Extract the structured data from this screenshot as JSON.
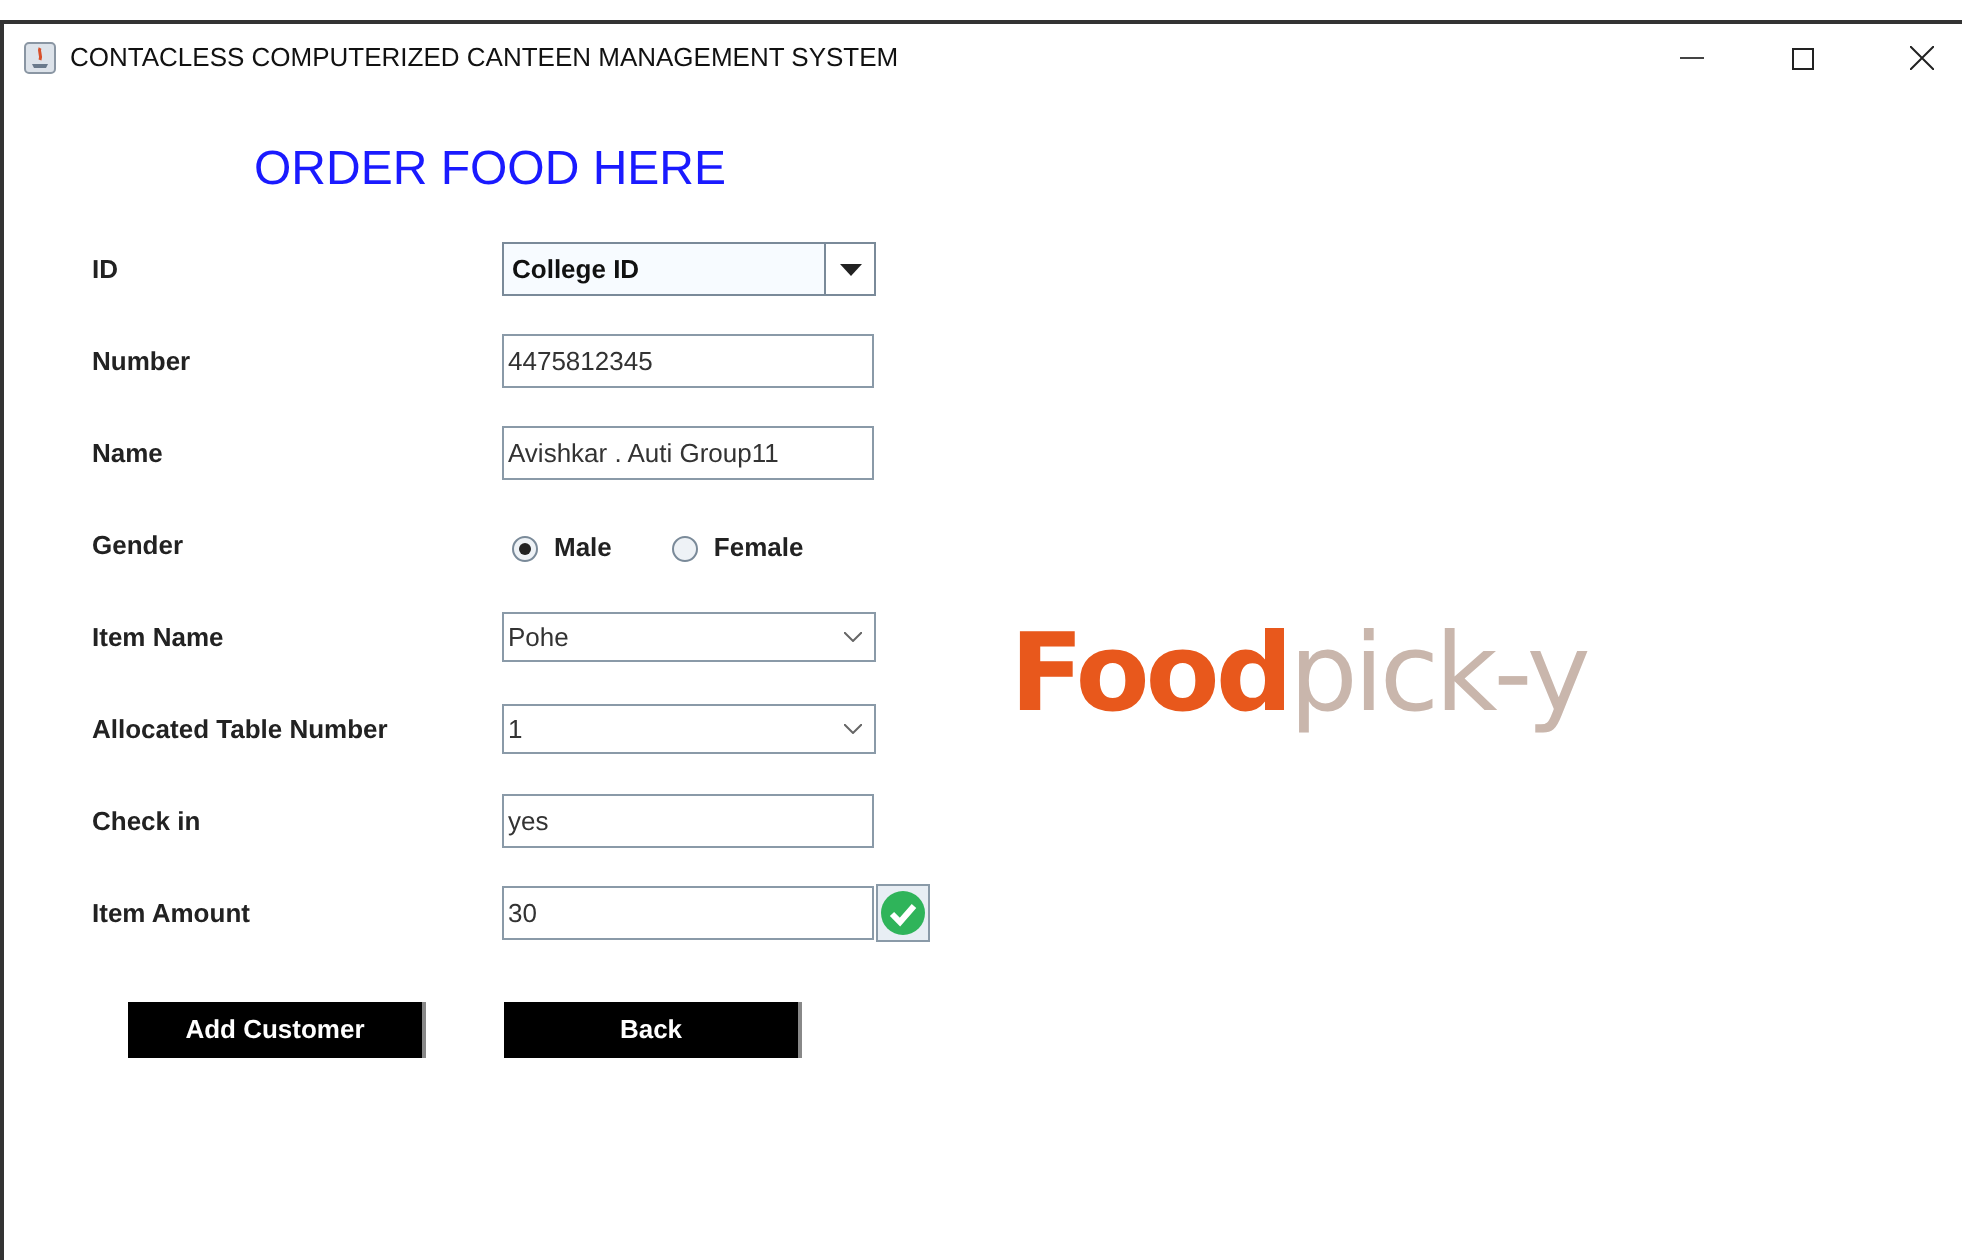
{
  "window": {
    "title": "CONTACLESS COMPUTERIZED CANTEEN MANAGEMENT SYSTEM"
  },
  "heading": "ORDER FOOD HERE",
  "fields": [
    {
      "label": "ID",
      "kind": "combo",
      "value": "College ID"
    },
    {
      "label": "Number",
      "kind": "text",
      "value": "4475812345"
    },
    {
      "label": "Name",
      "kind": "text",
      "value": "Avishkar . Auti Group11"
    },
    {
      "label": "Gender",
      "kind": "radio",
      "options": [
        {
          "label": "Male",
          "selected": true
        },
        {
          "label": "Female",
          "selected": false
        }
      ]
    },
    {
      "label": "Item Name",
      "kind": "select",
      "value": "Pohe"
    },
    {
      "label": "Allocated Table Number",
      "kind": "select",
      "value": "1"
    },
    {
      "label": "Check in",
      "kind": "text",
      "value": "yes"
    },
    {
      "label": "Item Amount",
      "kind": "text",
      "value": "30",
      "verified": true
    }
  ],
  "buttons": [
    "Add Customer",
    "Back"
  ],
  "logo": {
    "bold": "Food",
    "faint": "pick-y"
  }
}
